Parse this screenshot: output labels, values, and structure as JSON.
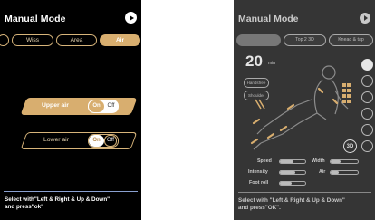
{
  "left": {
    "title": "Manual Mode",
    "tabs": [
      {
        "label": "Wiss"
      },
      {
        "label": "Area"
      },
      {
        "label": "Air"
      }
    ],
    "upper_air": {
      "label": "Upper air",
      "on": "On",
      "off": "Off"
    },
    "lower_air": {
      "label": "Lower air",
      "on": "On",
      "off": "Off"
    },
    "hint": [
      "Select with\"Left & Right & Up & Down\"",
      "and press\"ok\""
    ]
  },
  "right": {
    "title": "Manual Mode",
    "tabs": [
      {
        "label": ""
      },
      {
        "label": "Top 2 3D"
      },
      {
        "label": "Knead & tap"
      }
    ],
    "time": "20",
    "time_unit": "min",
    "pills": [
      "Handsfree",
      "Shoulder"
    ],
    "side_label": "3D",
    "stats": {
      "speed": "Speed",
      "width": "Width",
      "intensity": "Intensity",
      "air": "Air",
      "foot_roll": "Foot roll"
    },
    "levels": {
      "speed": 0.55,
      "width": 0.35,
      "intensity": 0.6,
      "air": 0.3,
      "foot_roll": 0.45
    },
    "hint": [
      "Select with \"Left & Right & Up & Down\"",
      "and press\"OK\"."
    ]
  },
  "colors": {
    "accent": "#d8ae6f",
    "left_bg": "#000000",
    "right_bg": "#353535"
  }
}
